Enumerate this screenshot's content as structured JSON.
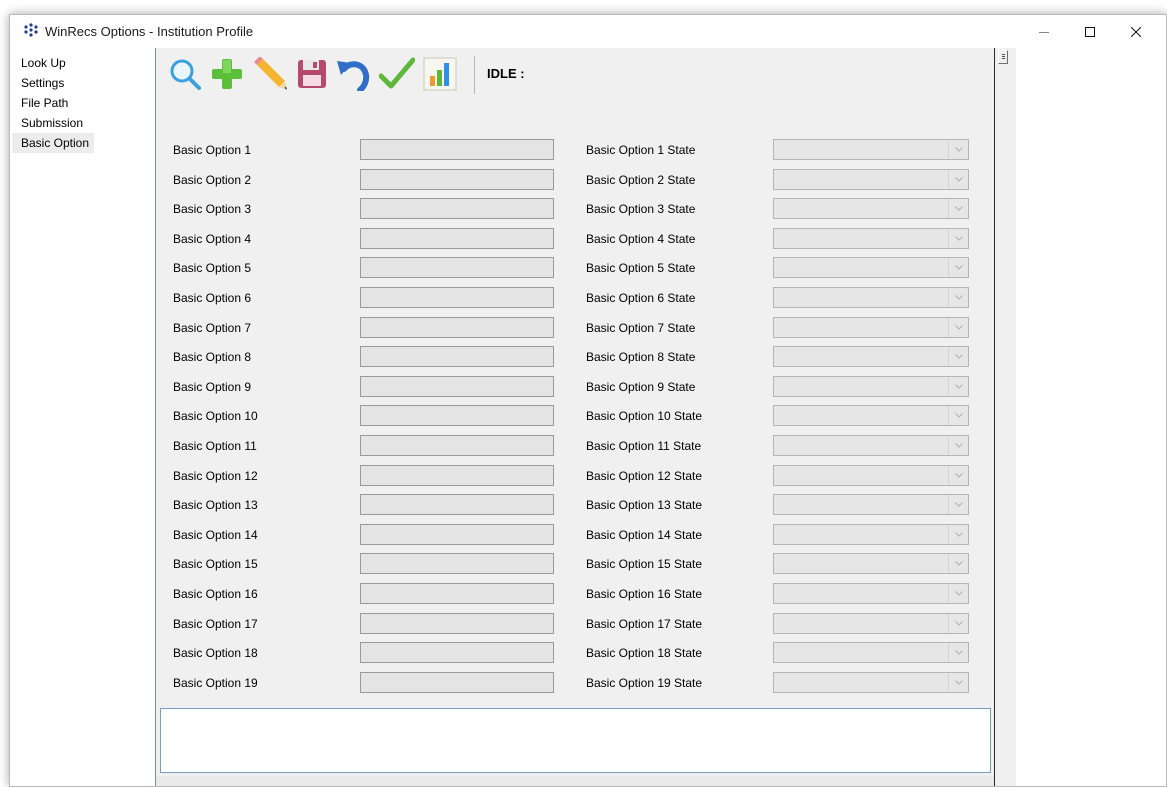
{
  "window": {
    "title": "WinRecs Options - Institution Profile",
    "icon": "dots-app-icon",
    "controls": [
      "minimize-icon",
      "maximize-icon",
      "close-icon"
    ]
  },
  "sidebar": {
    "items": [
      {
        "label": "Look Up"
      },
      {
        "label": "Settings"
      },
      {
        "label": "File Path"
      },
      {
        "label": "Submission"
      },
      {
        "label": "Basic Option",
        "selected": true
      }
    ]
  },
  "toolbar": {
    "buttons": [
      {
        "icon": "search-icon"
      },
      {
        "icon": "add-icon"
      },
      {
        "icon": "edit-pencil-icon"
      },
      {
        "icon": "save-icon"
      },
      {
        "icon": "undo-icon"
      },
      {
        "icon": "check-icon"
      },
      {
        "icon": "chart-icon"
      }
    ],
    "status": "IDLE :"
  },
  "form": {
    "rows": [
      {
        "label": "Basic Option 1",
        "value": "",
        "state_label": "Basic Option 1 State",
        "state_value": ""
      },
      {
        "label": "Basic Option 2",
        "value": "",
        "state_label": "Basic Option 2 State",
        "state_value": ""
      },
      {
        "label": "Basic Option 3",
        "value": "",
        "state_label": "Basic Option 3 State",
        "state_value": ""
      },
      {
        "label": "Basic Option 4",
        "value": "",
        "state_label": "Basic Option 4 State",
        "state_value": ""
      },
      {
        "label": "Basic Option 5",
        "value": "",
        "state_label": "Basic Option 5 State",
        "state_value": ""
      },
      {
        "label": "Basic Option 6",
        "value": "",
        "state_label": "Basic Option 6 State",
        "state_value": ""
      },
      {
        "label": "Basic Option 7",
        "value": "",
        "state_label": "Basic Option 7 State",
        "state_value": ""
      },
      {
        "label": "Basic Option 8",
        "value": "",
        "state_label": "Basic Option 8 State",
        "state_value": ""
      },
      {
        "label": "Basic Option 9",
        "value": "",
        "state_label": "Basic Option 9 State",
        "state_value": ""
      },
      {
        "label": "Basic Option 10",
        "value": "",
        "state_label": "Basic Option 10 State",
        "state_value": ""
      },
      {
        "label": "Basic Option 11",
        "value": "",
        "state_label": "Basic Option 11 State",
        "state_value": ""
      },
      {
        "label": "Basic Option 12",
        "value": "",
        "state_label": "Basic Option 12 State",
        "state_value": ""
      },
      {
        "label": "Basic Option 13",
        "value": "",
        "state_label": "Basic Option 13 State",
        "state_value": ""
      },
      {
        "label": "Basic Option 14",
        "value": "",
        "state_label": "Basic Option 14 State",
        "state_value": ""
      },
      {
        "label": "Basic Option 15",
        "value": "",
        "state_label": "Basic Option 15 State",
        "state_value": ""
      },
      {
        "label": "Basic Option 16",
        "value": "",
        "state_label": "Basic Option 16 State",
        "state_value": ""
      },
      {
        "label": "Basic Option 17",
        "value": "",
        "state_label": "Basic Option 17 State",
        "state_value": ""
      },
      {
        "label": "Basic Option 18",
        "value": "",
        "state_label": "Basic Option 18 State",
        "state_value": ""
      },
      {
        "label": "Basic Option 19",
        "value": "",
        "state_label": "Basic Option 19 State",
        "state_value": ""
      }
    ]
  },
  "message": {
    "text": ""
  }
}
